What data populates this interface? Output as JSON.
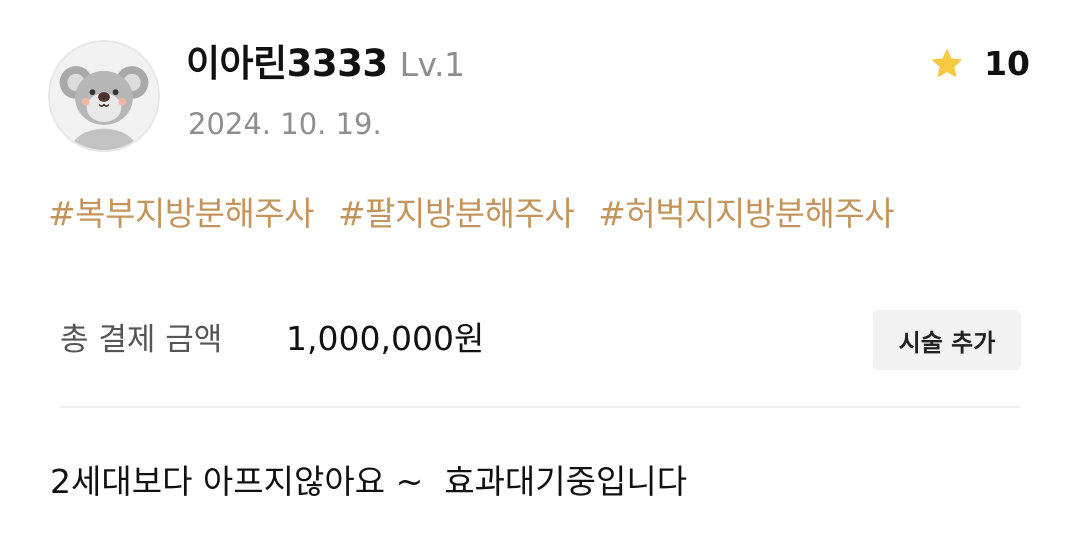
{
  "review": {
    "user": {
      "name": "이아린3333",
      "level": "Lv.1",
      "avatar": "koala-avatar"
    },
    "date": "2024. 10. 19.",
    "rating": {
      "icon": "star-icon",
      "value": "10",
      "color": "#f7c842"
    },
    "tags": [
      "#복부지방분해주사",
      "#팔지방분해주사",
      "#허벅지지방분해주사"
    ],
    "tag_color": "#c3955e",
    "payment": {
      "label": "총 결제 금액",
      "amount": "1,000,000원"
    },
    "add_treatment_label": "시술 추가",
    "body": "2세대보다 아프지않아요 ~  효과대기중입니다"
  }
}
